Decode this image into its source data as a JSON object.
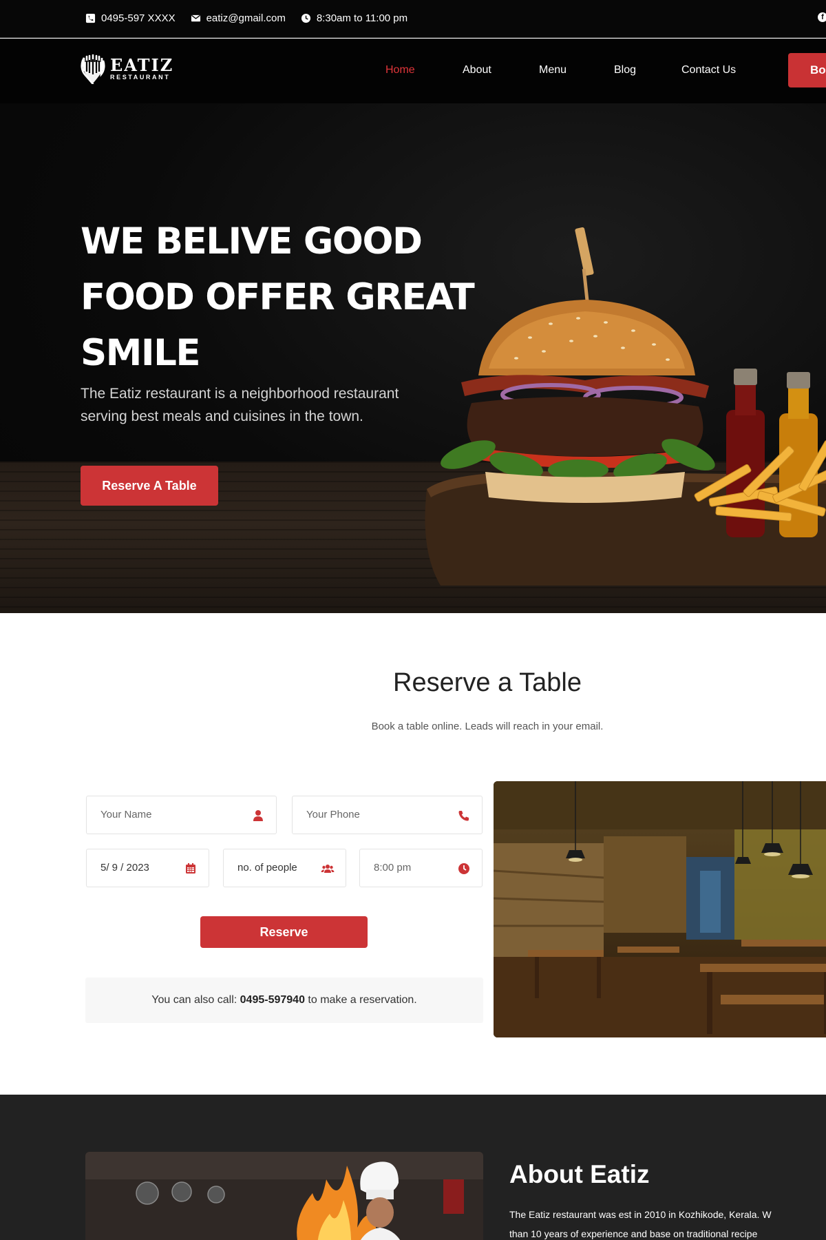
{
  "topbar": {
    "phone": "0495-597 XXXX",
    "email": "eatiz@gmail.com",
    "hours": "8:30am to 11:00 pm",
    "social_icon": "facebook-icon"
  },
  "brand": {
    "name": "EATIZ",
    "tagline": "RESTAURANT"
  },
  "nav": {
    "items": [
      {
        "label": "Home",
        "active": true
      },
      {
        "label": "About",
        "active": false
      },
      {
        "label": "Menu",
        "active": false
      },
      {
        "label": "Blog",
        "active": false
      },
      {
        "label": "Contact Us",
        "active": false
      }
    ],
    "book_label": "Bo"
  },
  "hero": {
    "title_line1": "WE BELIVE GOOD",
    "title_line2": "FOOD OFFER GREAT",
    "title_line3": "SMILE",
    "text_line1": "The Eatiz restaurant is a neighborhood restaurant",
    "text_line2": "serving best meals and cuisines in the town.",
    "button": "Reserve A Table"
  },
  "reserve": {
    "title": "Reserve a Table",
    "subtitle": "Book a table online. Leads will reach in your email.",
    "name_placeholder": "Your Name",
    "phone_placeholder": "Your Phone",
    "date_value": "5/ 9 / 2023",
    "people_value": "no. of people",
    "time_value": "8:00 pm",
    "button": "Reserve",
    "call_prefix": "You can also call:",
    "call_number": "0495-597940",
    "call_suffix": "to make a reservation."
  },
  "about": {
    "title": "About Eatiz",
    "text_line1": "The Eatiz restaurant was est in 2010 in Kozhikode, Kerala. W",
    "text_line2": "than 10 years of experience and base on traditional recipe"
  },
  "colors": {
    "accent": "#cc3436",
    "nav_active": "#e0353a",
    "dark_bg": "#050505",
    "about_bg": "#222222"
  }
}
